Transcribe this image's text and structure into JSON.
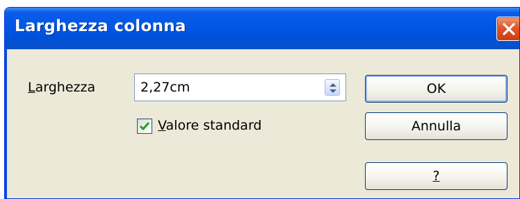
{
  "window": {
    "title": "Larghezza colonna"
  },
  "width_field": {
    "label_first": "L",
    "label_rest": "arghezza",
    "value": "2,27cm"
  },
  "default_value": {
    "checked": true,
    "label_first": "V",
    "label_rest": "alore standard"
  },
  "buttons": {
    "ok": "OK",
    "cancel": "Annulla",
    "help": "?"
  },
  "icons": {
    "close": "close-icon",
    "spin": "spin-arrows-icon",
    "check": "checkmark-icon"
  },
  "colors": {
    "titlebar": "#0058e6",
    "dialog_bg": "#ece9d8",
    "close_btn": "#e2572b",
    "check": "#21a121"
  }
}
